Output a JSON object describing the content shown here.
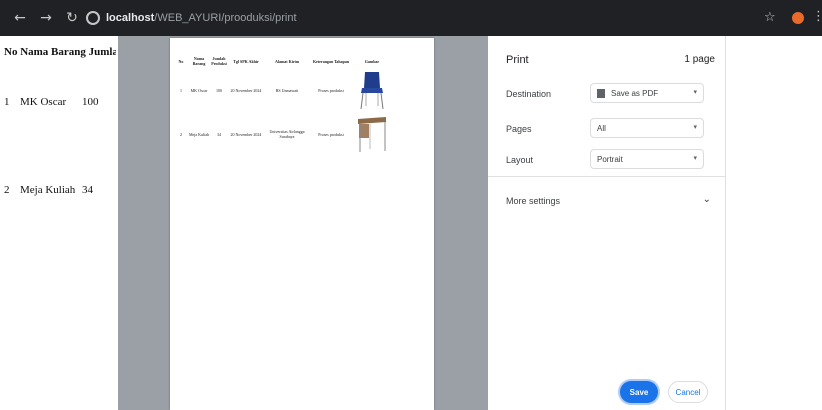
{
  "browser": {
    "url_host": "localhost",
    "url_path": "/WEB_AYURI/prooduksi/print"
  },
  "page": {
    "header": "No Nama Barang Jumlah",
    "rows": [
      {
        "no": "1",
        "nama": "MK Oscar",
        "jumlah": "100"
      },
      {
        "no": "2",
        "nama": "Meja Kuliah",
        "jumlah": "34"
      }
    ]
  },
  "preview": {
    "headers": {
      "no": "No",
      "nama": "Nama Barang",
      "jumlah": "Jumlah Produksi",
      "tgl": "Tgl SPK Akhir",
      "alamat": "Alamat Kirim",
      "keterangan": "Keterangan Tahapan",
      "gambar": "Gambar"
    },
    "rows": [
      {
        "no": "1",
        "nama": "MK Oscar",
        "jumlah": "100",
        "tgl": "20 November 2024",
        "alamat": "RS Unmawati",
        "keterangan": "Proses produksi"
      },
      {
        "no": "2",
        "nama": "Meja Kuliah",
        "jumlah": "34",
        "tgl": "20 November 2024",
        "alamat": "Universitas Airlangga Surabaya",
        "keterangan": "Proses produksi"
      }
    ]
  },
  "print_panel": {
    "title": "Print",
    "page_count": "1 page",
    "destination_label": "Destination",
    "destination_value": "Save as PDF",
    "pages_label": "Pages",
    "pages_value": "All",
    "layout_label": "Layout",
    "layout_value": "Portrait",
    "more_settings": "More settings",
    "save_label": "Save",
    "cancel_label": "Cancel"
  },
  "colors": {
    "chrome": "#202124",
    "preview_bg": "#9aa0a6",
    "primary": "#1a73e8"
  }
}
